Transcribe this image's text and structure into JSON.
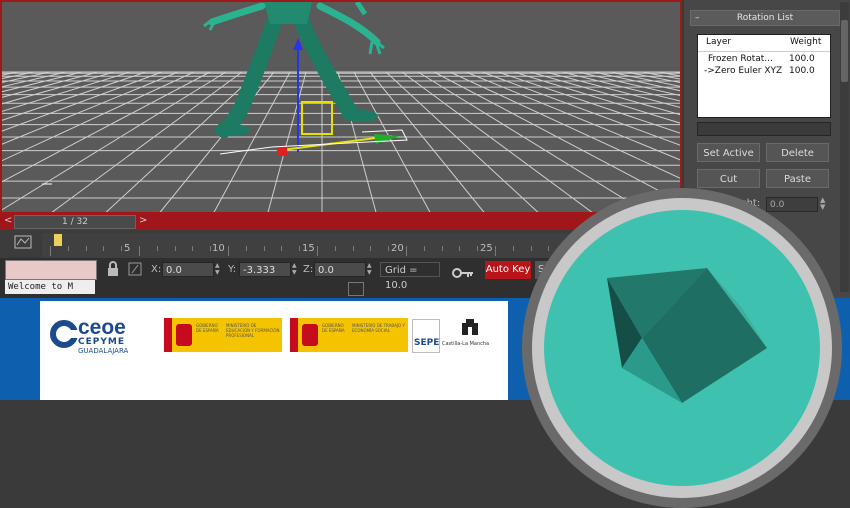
{
  "command_panel": {
    "rollout_title": "Rotation List",
    "rollout_toggle": "–",
    "list_columns": [
      "Layer",
      "Weight"
    ],
    "layers": [
      {
        "name": "Frozen Rotat...",
        "weight": "100.0"
      },
      {
        "name": "->Zero Euler XYZ",
        "weight": "100.0"
      }
    ],
    "buttons": {
      "set_active": "Set Active",
      "delete": "Delete",
      "cut": "Cut",
      "paste": "Paste"
    },
    "weight_label": "Weight:",
    "weight_value": "0.0"
  },
  "time_slider": {
    "frame_display": "1 / 32",
    "left_arrow": "<",
    "right_arrow": ">"
  },
  "track_bar": {
    "ticks": [
      "5",
      "10",
      "15",
      "20",
      "25"
    ]
  },
  "status_bar": {
    "listener_text": "Welcome to M",
    "x_label": "X:",
    "x_value": "0.0",
    "y_label": "Y:",
    "y_value": "-3.333",
    "z_label": "Z:",
    "z_value": "0.0",
    "grid_text": "Grid = 10.0",
    "auto_key": "Auto Key",
    "set_key": "Se"
  },
  "colors": {
    "accent_red": "#b8151a",
    "banner_blue": "#0e5fae",
    "badge_teal": "#3fc1b0"
  },
  "icons": [
    "lock-icon",
    "key-icon",
    "autodesk-3dsmax-logo",
    "ceoe-logo",
    "spain-coat-of-arms",
    "castilla-la-mancha-logo"
  ],
  "sponsors": {
    "ceoe_main": "ceoe",
    "ceoe_sub": "CEPYME",
    "ceoe_city": "GUADALAJARA",
    "gob1_a": "GOBIERNO DE ESPAÑA",
    "gob1_b": "MINISTERIO DE EDUCACIÓN Y FORMACIÓN PROFESIONAL",
    "gob2_a": "GOBIERNO DE ESPAÑA",
    "gob2_b": "MINISTERIO DE TRABAJO Y ECONOMÍA SOCIAL",
    "sepe": "SEPE",
    "clm": "Castilla-La Mancha"
  }
}
